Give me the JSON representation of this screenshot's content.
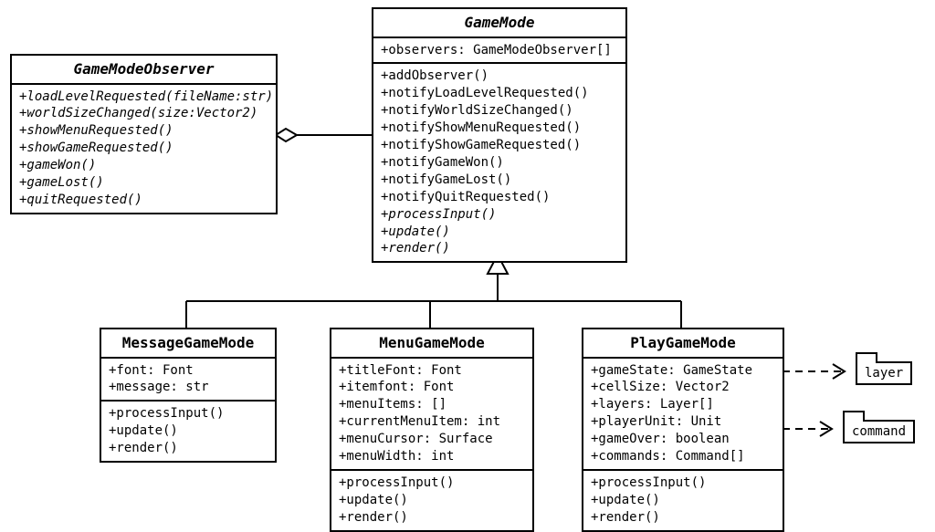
{
  "classes": {
    "observer": {
      "name": "GameModeObserver",
      "methods": [
        "+loadLevelRequested(fileName:str)",
        "+worldSizeChanged(size:Vector2)",
        "+showMenuRequested()",
        "+showGameRequested()",
        "+gameWon()",
        "+gameLost()",
        "+quitRequested()"
      ]
    },
    "gamemode": {
      "name": "GameMode",
      "attrs": [
        "+observers: GameModeObserver[]"
      ],
      "methods": [
        {
          "t": "+addObserver()",
          "i": false
        },
        {
          "t": "+notifyLoadLevelRequested()",
          "i": false
        },
        {
          "t": "+notifyWorldSizeChanged()",
          "i": false
        },
        {
          "t": "+notifyShowMenuRequested()",
          "i": false
        },
        {
          "t": "+notifyShowGameRequested()",
          "i": false
        },
        {
          "t": "+notifyGameWon()",
          "i": false
        },
        {
          "t": "+notifyGameLost()",
          "i": false
        },
        {
          "t": "+notifyQuitRequested()",
          "i": false
        },
        {
          "t": "+processInput()",
          "i": true
        },
        {
          "t": "+update()",
          "i": true
        },
        {
          "t": "+render()",
          "i": true
        }
      ]
    },
    "message": {
      "name": "MessageGameMode",
      "attrs": [
        "+font: Font",
        "+message: str"
      ],
      "methods": [
        "+processInput()",
        "+update()",
        "+render()"
      ]
    },
    "menu": {
      "name": "MenuGameMode",
      "attrs": [
        "+titleFont: Font",
        "+itemfont: Font",
        "+menuItems: []",
        "+currentMenuItem: int",
        "+menuCursor: Surface",
        "+menuWidth: int"
      ],
      "methods": [
        "+processInput()",
        "+update()",
        "+render()"
      ]
    },
    "play": {
      "name": "PlayGameMode",
      "attrs": [
        "+gameState: GameState",
        "+cellSize: Vector2",
        "+layers: Layer[]",
        "+playerUnit: Unit",
        "+gameOver: boolean",
        "+commands: Command[]"
      ],
      "methods": [
        "+processInput()",
        "+update()",
        "+render()"
      ]
    }
  },
  "packages": {
    "layer": "layer",
    "command": "command"
  }
}
